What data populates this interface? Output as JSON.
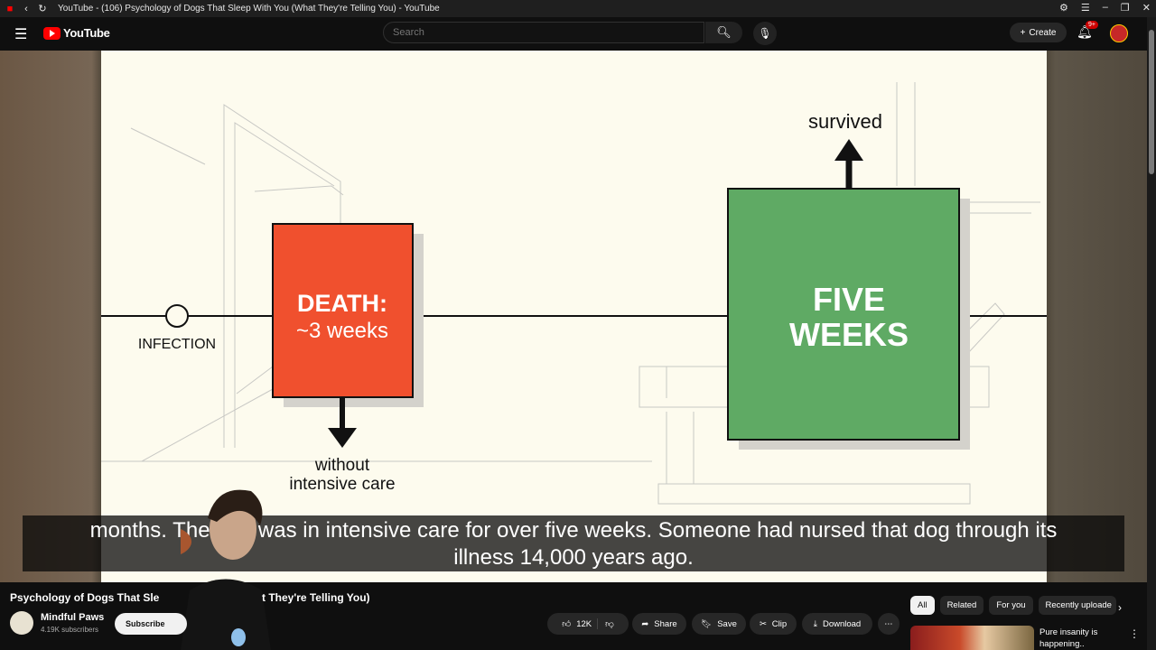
{
  "window": {
    "title": "YouTube - (106) Psychology of Dogs That Sleep With You (What They're Telling You) - YouTube"
  },
  "header": {
    "logo_text": "YouTube",
    "search_placeholder": "Search",
    "create_label": "Create",
    "notifications_badge": "9+"
  },
  "video_frame": {
    "infection_label": "INFECTION",
    "death_line1": "DEATH:",
    "death_line2": "~3 weeks",
    "without_line1": "without",
    "without_line2": "intensive care",
    "survived_label": "survived",
    "five_line1": "FIVE",
    "five_line2": "WEEKS",
    "colors": {
      "death_box": "#f0502e",
      "five_weeks_box": "#5faa64",
      "background": "#fdfbee"
    }
  },
  "captions": {
    "line1": "months. The dog was in intensive care for over five weeks. Someone had nursed that dog through its",
    "line2": "illness 14,000 years ago."
  },
  "video": {
    "title_start": "Psychology of Dogs That Sle",
    "title_end": "t They're Telling You)",
    "channel_name": "Mindful Paws",
    "subscribers": "4.19K subscribers",
    "subscribe_label": "Subscribe"
  },
  "actions": {
    "likes": "12K",
    "share": "Share",
    "save": "Save",
    "clip": "Clip",
    "download": "Download"
  },
  "chips": [
    "All",
    "Related",
    "For you",
    "Recently uploade"
  ],
  "recommendation": {
    "title_line1": "Pure insanity is",
    "title_line2": "happening.."
  }
}
